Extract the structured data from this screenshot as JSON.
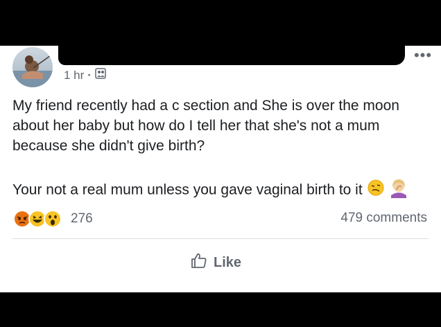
{
  "post": {
    "author_name": "",
    "time": "1 hr",
    "privacy_icon": "friends-icon",
    "paragraph_1": "My friend recently had a c section and She is over the moon about her baby but how do I tell her that she's not a mum because she didn't give birth?",
    "paragraph_2": "Your not a real mum unless you gave vaginal birth to it",
    "reaction_icons": [
      "angry-icon",
      "haha-icon",
      "wow-icon"
    ],
    "reaction_count": "276",
    "comment_count": "479 comments",
    "like_label": "Like"
  }
}
